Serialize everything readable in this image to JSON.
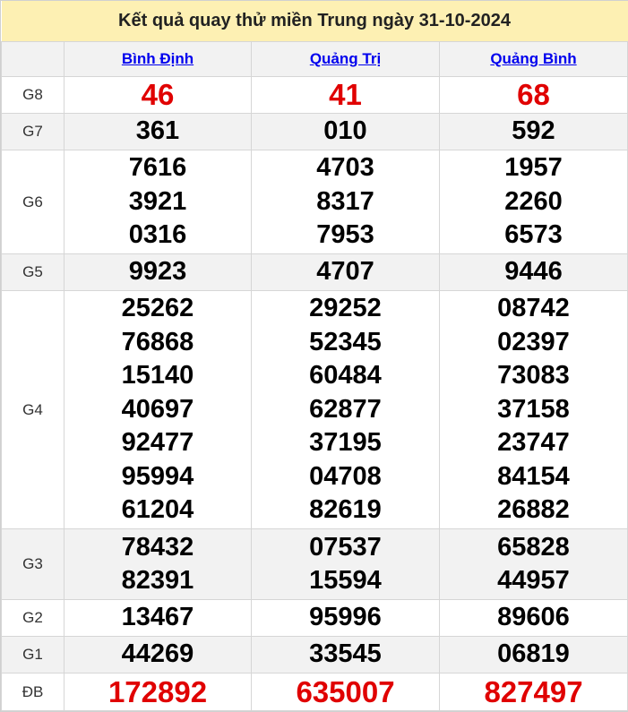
{
  "title": "Kết quả quay thử miền Trung ngày 31-10-2024",
  "provinces": [
    "Bình Định",
    "Quảng Trị",
    "Quảng Bình"
  ],
  "prizes": [
    {
      "label": "G8",
      "values": [
        [
          "46"
        ],
        [
          "41"
        ],
        [
          "68"
        ]
      ]
    },
    {
      "label": "G7",
      "values": [
        [
          "361"
        ],
        [
          "010"
        ],
        [
          "592"
        ]
      ]
    },
    {
      "label": "G6",
      "values": [
        [
          "7616",
          "3921",
          "0316"
        ],
        [
          "4703",
          "8317",
          "7953"
        ],
        [
          "1957",
          "2260",
          "6573"
        ]
      ]
    },
    {
      "label": "G5",
      "values": [
        [
          "9923"
        ],
        [
          "4707"
        ],
        [
          "9446"
        ]
      ]
    },
    {
      "label": "G4",
      "values": [
        [
          "25262",
          "76868",
          "15140",
          "40697",
          "92477",
          "95994",
          "61204"
        ],
        [
          "29252",
          "52345",
          "60484",
          "62877",
          "37195",
          "04708",
          "82619"
        ],
        [
          "08742",
          "02397",
          "73083",
          "37158",
          "23747",
          "84154",
          "26882"
        ]
      ]
    },
    {
      "label": "G3",
      "values": [
        [
          "78432",
          "82391"
        ],
        [
          "07537",
          "15594"
        ],
        [
          "65828",
          "44957"
        ]
      ]
    },
    {
      "label": "G2",
      "values": [
        [
          "13467"
        ],
        [
          "95996"
        ],
        [
          "89606"
        ]
      ]
    },
    {
      "label": "G1",
      "values": [
        [
          "44269"
        ],
        [
          "33545"
        ],
        [
          "06819"
        ]
      ]
    },
    {
      "label": "ĐB",
      "values": [
        [
          "172892"
        ],
        [
          "635007"
        ],
        [
          "827497"
        ]
      ]
    }
  ],
  "colors": {
    "title_bg": "#fdf0b3",
    "header_bg": "#f2f2f2",
    "special_red": "#e00000",
    "link_blue": "#0000ee"
  }
}
